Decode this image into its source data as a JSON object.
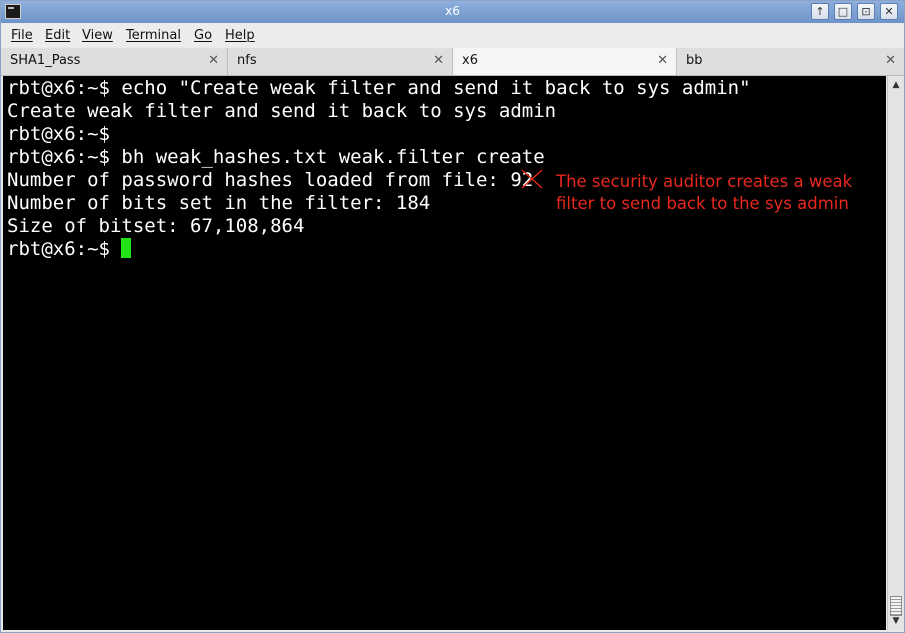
{
  "window": {
    "title": "x6",
    "buttons": {
      "up": "↑",
      "minimize": "□",
      "maximize": "⊡",
      "close": "✕"
    }
  },
  "menu": [
    "File",
    "Edit",
    "View",
    "Terminal",
    "Go",
    "Help"
  ],
  "tabs": [
    {
      "label": "SHA1_Pass",
      "active": false
    },
    {
      "label": "nfs",
      "active": false
    },
    {
      "label": "x6",
      "active": true
    },
    {
      "label": "bb",
      "active": false
    }
  ],
  "terminal": {
    "lines": [
      "rbt@x6:~$ echo \"Create weak filter and send it back to sys admin\"",
      "Create weak filter and send it back to sys admin",
      "rbt@x6:~$",
      "rbt@x6:~$ bh weak_hashes.txt weak.filter create",
      "Number of password hashes loaded from file: 92",
      "Number of bits set in the filter: 184",
      "Size of bitset: 67,108,864"
    ],
    "prompt": "rbt@x6:~$ ",
    "cursor_color": "#22e414"
  },
  "annotation": {
    "line1": "The security auditor creates a weak",
    "line2": "filter to send back to the sys admin",
    "color": "#e8281e"
  },
  "icons": {
    "app": "terminal-icon",
    "tab_close": "close-icon",
    "scroll_up": "arrow-up-icon",
    "scroll_down": "arrow-down-icon"
  }
}
